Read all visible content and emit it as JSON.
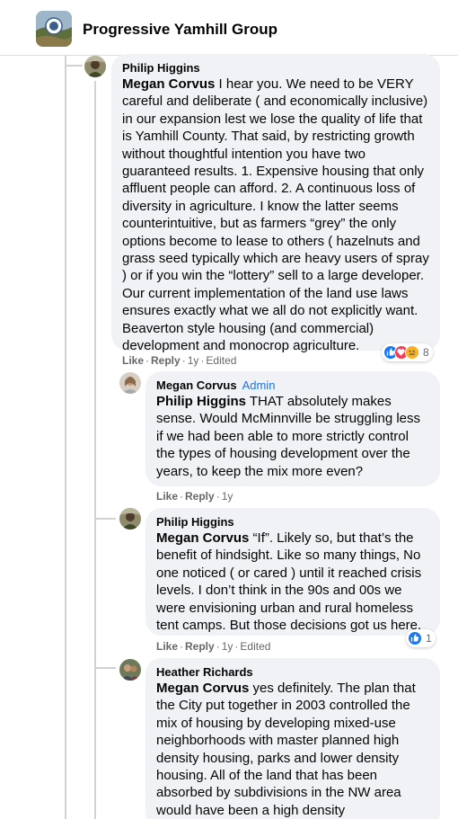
{
  "header": {
    "group_name": "Progressive Yamhill Group",
    "avatar_icon": "group-logo-icon"
  },
  "comments": [
    {
      "author": "Philip Higgins",
      "mention": "Megan Corvus",
      "text": " I hear you. We need to be VERY careful and deliberate ( and economically inclusive) in our expansion lest we lose the quality of life that is Yamhill County. That said, by restricting growth without thoughtful intention you have two guaranteed results. 1. Expensive housing that only affluent people can afford. 2. A continuous loss of diversity in agriculture. I know the latter seems counterintuitive, but as farmers “grey” the only options become to lease to others ( hazelnuts and grass seed typically which are heavy users of spray ) or if you win the “lottery” sell to a large developer. Our current implementation of the land use laws ensures exactly what we all do not explicitly want. Beaverton style housing (and commercial) development and monocrop agriculture.",
      "like": "Like",
      "reply": "Reply",
      "time": "1y",
      "edited": "Edited",
      "reaction_count": "8",
      "reactions": [
        "like-icon",
        "love-icon",
        "sad-icon"
      ]
    },
    {
      "author": "Megan Corvus",
      "badge": "Admin",
      "mention": "Philip Higgins",
      "text": " THAT absolutely makes sense. Would McMinnville be struggling less if we had been able to more strictly control the types of housing development over the years, to keep the mix more even?",
      "like": "Like",
      "reply": "Reply",
      "time": "1y"
    },
    {
      "author": "Philip Higgins",
      "mention": "Megan Corvus",
      "text": " “If”. Likely so, but that’s the benefit of hindsight. Like so many things, No one noticed ( or cared ) until it reached crisis levels. I don’t think in the 90s and 00s we were envisioning urban and rural homeless tent camps. But those decisions got us here.",
      "like": "Like",
      "reply": "Reply",
      "time": "1y",
      "edited": "Edited",
      "reaction_count": "1",
      "reactions": [
        "like-icon"
      ]
    },
    {
      "author": "Heather Richards",
      "mention": "Megan Corvus",
      "text": " yes definitely. The plan that the City put together in 2003 controlled the mix of housing by developing mixed-use neighborhoods with master planned high density housing, parks and lower density housing. All of the land that has been absorbed by subdivisions in the NW area would have been a high density neighborhood and the areas in and"
    }
  ],
  "colors": {
    "bubble": "#f0f2f5",
    "link_blue": "#1b74e4",
    "like_blue": "#1877f2",
    "love_red": "#f33e58",
    "sad_yellow": "#f7b125",
    "meta_grey": "#65676b"
  }
}
